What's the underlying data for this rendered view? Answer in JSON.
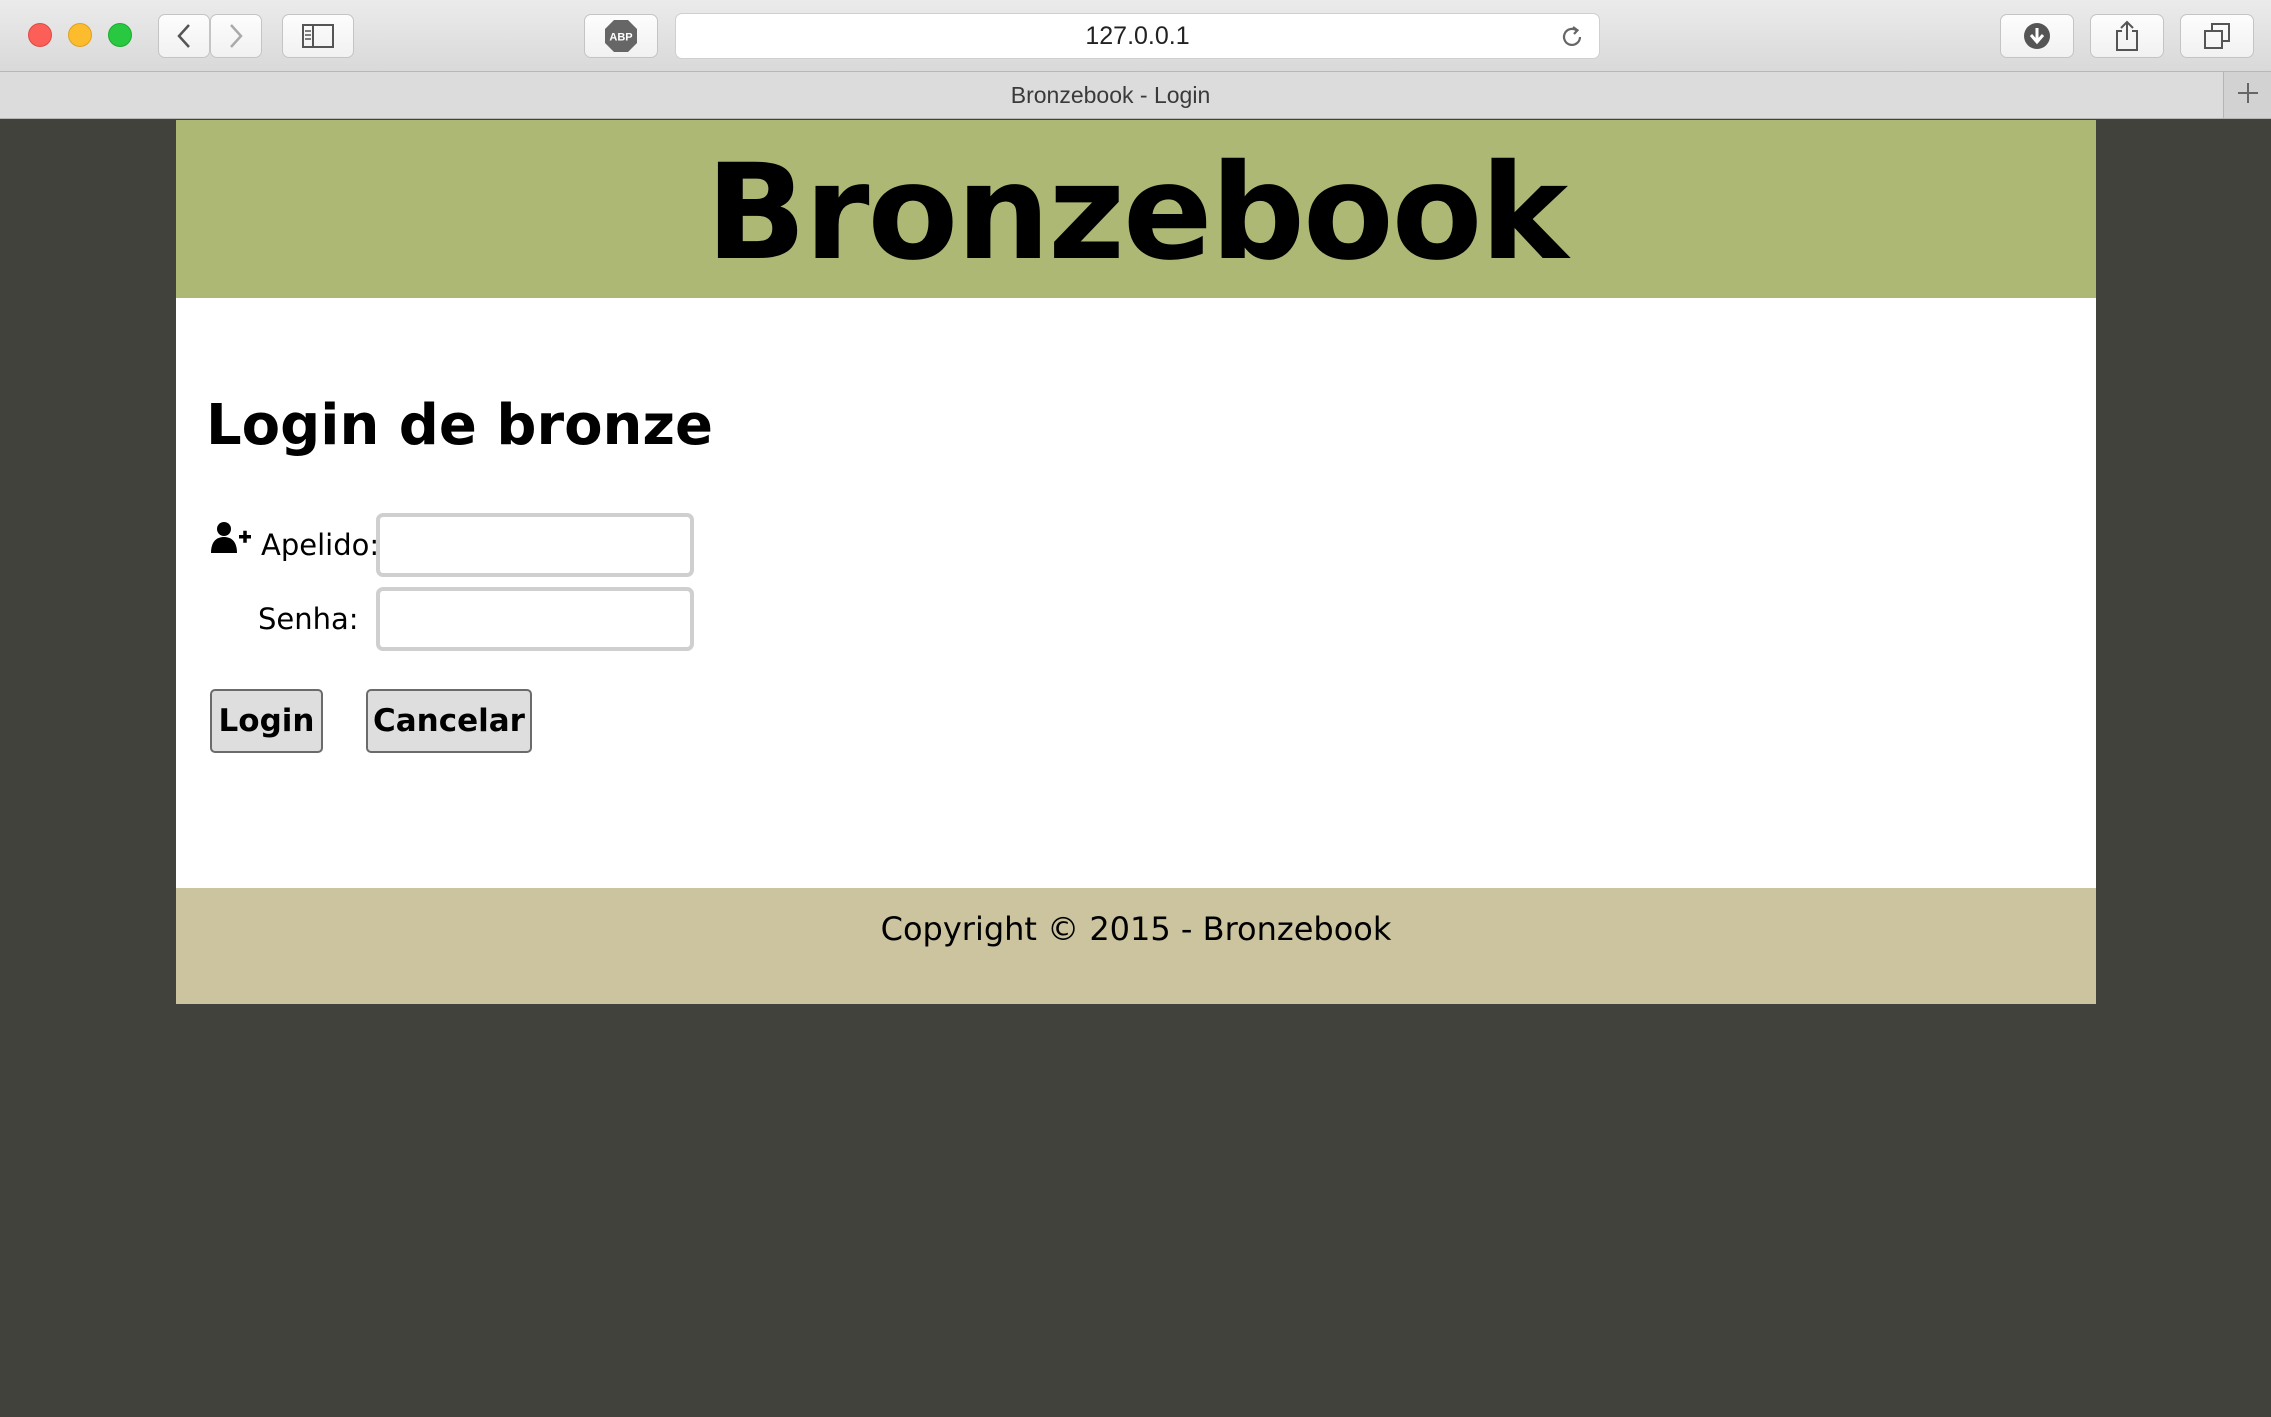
{
  "browser": {
    "url": "127.0.0.1",
    "tab_title": "Bronzebook - Login",
    "adblock_label": "ABP",
    "icons": {
      "back": "chevron-left-icon",
      "forward": "chevron-right-icon",
      "sidebar": "sidebar-icon",
      "reload": "reload-icon",
      "downloads": "download-icon",
      "share": "share-icon",
      "tabs": "tab-overview-icon",
      "new_tab": "plus-icon"
    }
  },
  "site": {
    "title": "Bronzebook",
    "header_color": "#acb874",
    "footer_color": "#cbc49f",
    "background_color": "#42423d"
  },
  "login": {
    "heading": "Login de bronze",
    "user_icon": "user-add-icon",
    "apelido_label": "Apelido:",
    "apelido_value": "",
    "senha_label": "Senha:",
    "senha_value": "",
    "login_button": "Login",
    "cancel_button": "Cancelar"
  },
  "footer": {
    "copyright": "Copyright © 2015 - Bronzebook"
  }
}
